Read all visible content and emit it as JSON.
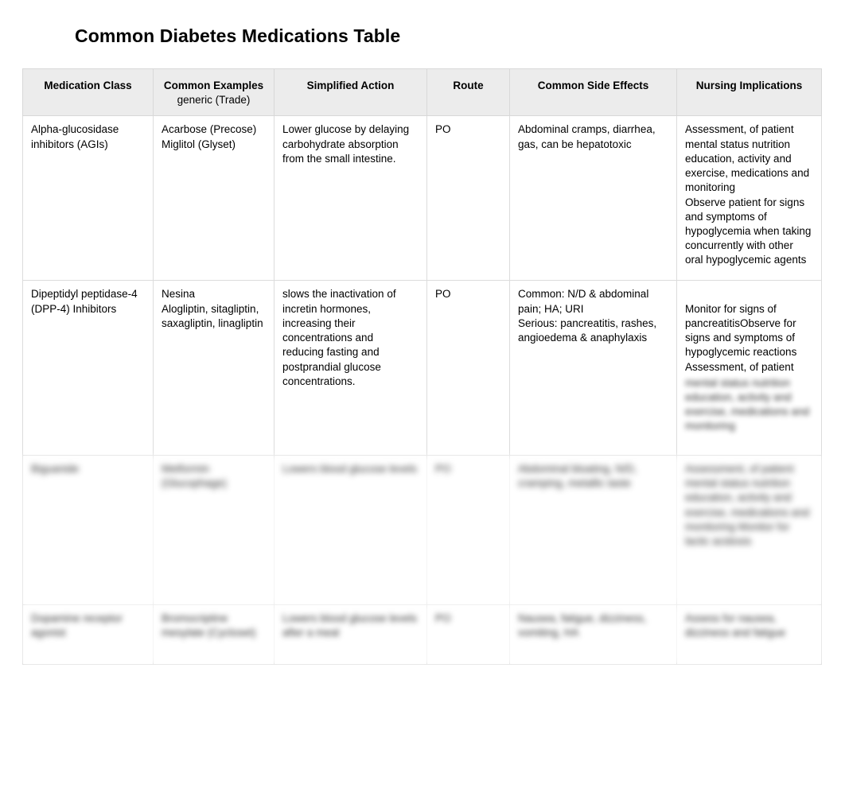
{
  "document": {
    "title": "Common Diabetes Medications Table"
  },
  "table": {
    "headers": [
      {
        "label": "Medication Class",
        "sub": ""
      },
      {
        "label": "Common Examples",
        "sub": "generic (Trade)"
      },
      {
        "label": "Simplified Action",
        "sub": ""
      },
      {
        "label": "Route",
        "sub": ""
      },
      {
        "label": "Common Side Effects",
        "sub": ""
      },
      {
        "label": "Nursing Implications",
        "sub": ""
      }
    ],
    "rows": [
      {
        "medication_class": "Alpha-glucosidase inhibitors (AGIs)",
        "common_examples": "Acarbose (Precose)\nMiglitol (Glyset)",
        "simplified_action": "Lower glucose by delaying carbohydrate absorption from the small intestine.",
        "route": "PO",
        "side_effects": "Abdominal cramps, diarrhea, gas, can be hepatotoxic",
        "nursing_implications": "Assessment, of patient mental status nutrition education, activity and exercise, medications and monitoring\nObserve patient for signs and symptoms of hypoglycemia when taking concurrently with other oral hypoglycemic agents",
        "nursing_implications_blurred": ""
      },
      {
        "medication_class": "Dipeptidyl peptidase-4 (DPP-4) Inhibitors",
        "common_examples": "Nesina\nAlogliptin, sitagliptin, saxagliptin, linagliptin",
        "simplified_action": "slows the inactivation of incretin hormones, increasing their concentrations and\nreducing fasting and postprandial glucose concentrations.",
        "route": "PO",
        "side_effects": "Common: N/D & abdominal pain; HA; URI\nSerious: pancreatitis, rashes, angioedema & anaphylaxis",
        "nursing_implications": "Monitor for signs of pancreatitisObserve for signs and symptoms of hypoglycemic reactions\nAssessment, of patient",
        "nursing_implications_blurred": "mental status nutrition education, activity and exercise, medications and monitoring"
      },
      {
        "medication_class": "Biguanide",
        "common_examples": "Metformin (Glucophage)",
        "simplified_action": "Lowers blood glucose levels",
        "route": "PO",
        "side_effects": "Abdominal bloating, N/D, cramping, metallic taste",
        "nursing_implications": "Assessment, of patient mental status nutrition education, activity and exercise, medications and monitoring Monitor for lactic acidosis",
        "nursing_implications_blurred": ""
      },
      {
        "medication_class": "Dopamine receptor agonist",
        "common_examples": "Bromocriptine mesylate (Cycloset)",
        "simplified_action": "Lowers blood glucose levels after a meal",
        "route": "PO",
        "side_effects": "Nausea, fatigue, dizziness, vomiting, HA",
        "nursing_implications": "Assess for nausea, dizziness and fatigue",
        "nursing_implications_blurred": ""
      }
    ]
  },
  "colors": {
    "header_background": "#ececec",
    "border": "#dcdcdc",
    "text": "#000000",
    "page_background": "#ffffff"
  }
}
